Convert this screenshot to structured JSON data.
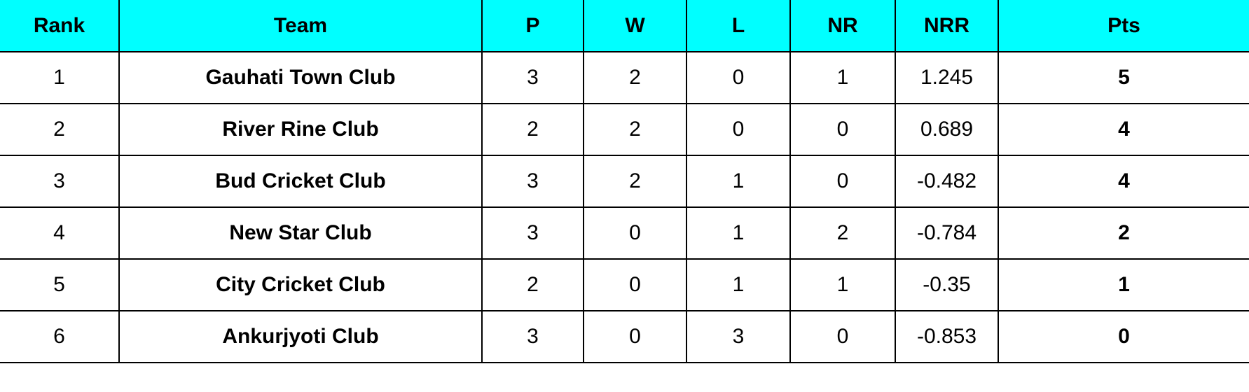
{
  "table": {
    "accent_header_bg": "#00FFFF",
    "text_color": "#000000",
    "border_color": "#000000",
    "columns": [
      {
        "key": "rank",
        "label": "Rank"
      },
      {
        "key": "team",
        "label": "Team"
      },
      {
        "key": "p",
        "label": "P"
      },
      {
        "key": "w",
        "label": "W"
      },
      {
        "key": "l",
        "label": "L"
      },
      {
        "key": "nr",
        "label": "NR"
      },
      {
        "key": "nrr",
        "label": "NRR"
      },
      {
        "key": "pts",
        "label": "Pts"
      }
    ],
    "rows": [
      {
        "rank": "1",
        "team": "Gauhati Town Club",
        "p": "3",
        "w": "2",
        "l": "0",
        "nr": "1",
        "nrr": "1.245",
        "pts": "5"
      },
      {
        "rank": "2",
        "team": "River Rine Club",
        "p": "2",
        "w": "2",
        "l": "0",
        "nr": "0",
        "nrr": "0.689",
        "pts": "4"
      },
      {
        "rank": "3",
        "team": "Bud Cricket Club",
        "p": "3",
        "w": "2",
        "l": "1",
        "nr": "0",
        "nrr": "-0.482",
        "pts": "4"
      },
      {
        "rank": "4",
        "team": "New Star Club",
        "p": "3",
        "w": "0",
        "l": "1",
        "nr": "2",
        "nrr": "-0.784",
        "pts": "2"
      },
      {
        "rank": "5",
        "team": "City Cricket Club",
        "p": "2",
        "w": "0",
        "l": "1",
        "nr": "1",
        "nrr": "-0.35",
        "pts": "1"
      },
      {
        "rank": "6",
        "team": "Ankurjyoti Club",
        "p": "3",
        "w": "0",
        "l": "3",
        "nr": "0",
        "nrr": "-0.853",
        "pts": "0"
      }
    ]
  }
}
